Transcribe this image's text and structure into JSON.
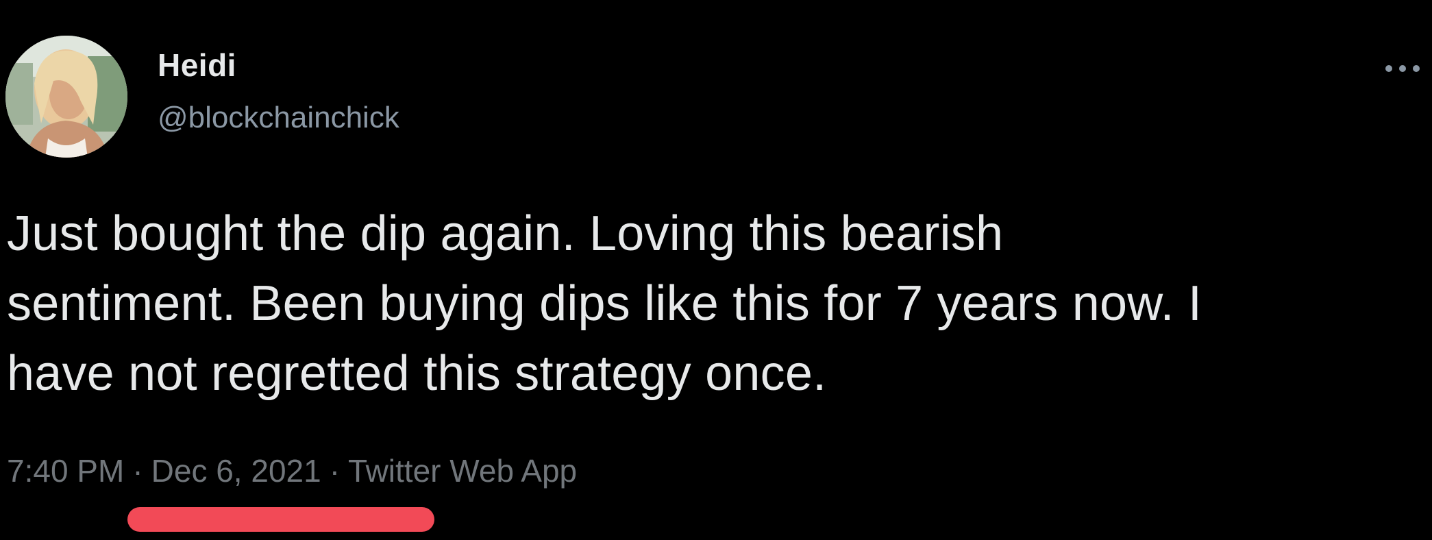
{
  "tweet": {
    "author": {
      "display_name": "Heidi",
      "handle": "@blockchainchick"
    },
    "text": "Just bought the dip again. Loving this bearish\nsentiment. Been buying dips like this for 7 years now. I\nhave not regretted this strategy once.",
    "meta": {
      "time": "7:40 PM",
      "separator": "·",
      "date": "Dec 6, 2021",
      "source": "Twitter Web App"
    },
    "more_icon": "more-horizontal-icon"
  },
  "colors": {
    "background": "#000000",
    "primary_text": "#e7e9ea",
    "secondary_text": "#71767b",
    "highlight": "#f24a57"
  }
}
